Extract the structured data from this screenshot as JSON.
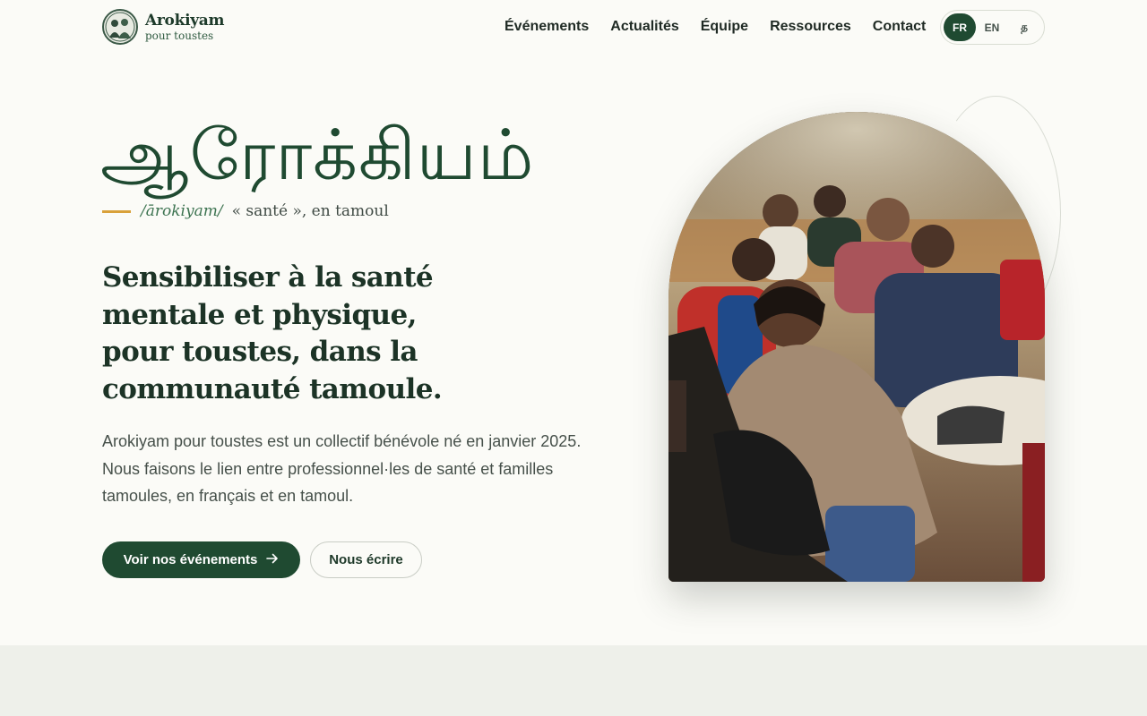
{
  "brand": {
    "name": "Arokiyam",
    "tagline": "pour toustes"
  },
  "nav": {
    "items": [
      {
        "label": "Événements",
        "name": "nav-evenements"
      },
      {
        "label": "Actualités",
        "name": "nav-actualites"
      },
      {
        "label": "Équipe",
        "name": "nav-equipe"
      },
      {
        "label": "Ressources",
        "name": "nav-ressources"
      },
      {
        "label": "Contact",
        "name": "nav-contact"
      }
    ]
  },
  "language": {
    "options": [
      "FR",
      "EN",
      "த"
    ],
    "selected": "FR"
  },
  "hero": {
    "tamil_word": "ஆரோக்கியம்",
    "pronunciation": "/ārokiyam/",
    "meaning": "« santé », en tamoul",
    "headline": "Sensibiliser à la santé mentale et physique, pour toustes, dans la communauté tamoule.",
    "intro": "Arokiyam pour toustes est un collectif bénévole né en janvier 2025. Nous faisons le lien entre professionnel·les de santé et familles tamoules, en français et en tamoul.",
    "primary_cta": "Voir nos événements",
    "secondary_cta": "Nous écrire"
  },
  "colors": {
    "brand_green": "#1f4a31",
    "accent_gold": "#d9a13a",
    "background": "#fbfbf7",
    "band": "#eef0ea"
  },
  "icons": {
    "arrow": "arrow-right-icon"
  }
}
